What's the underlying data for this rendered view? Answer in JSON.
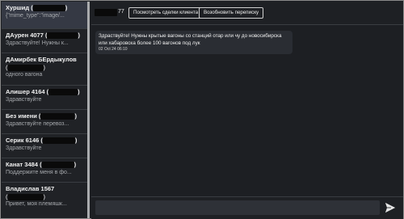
{
  "sidebar": {
    "items": [
      {
        "name": "Хуршид (",
        "name_end": ")",
        "preview": "{\"mime_type\":\"image/...",
        "active": true
      },
      {
        "name": "ДАурен 4077 (",
        "name_end": ")",
        "preview": "Здраствуйте! Нужны к...",
        "active": false
      },
      {
        "name": "ДАмирбек БЕрдыкулов",
        "line2": "(",
        "line2_end": ")",
        "preview": "одного вагона",
        "active": false
      },
      {
        "name": "Алишер 4164 (",
        "name_end": ")",
        "preview": "Здравствуйте",
        "active": false
      },
      {
        "name": "Без имени (",
        "name_end": ")",
        "preview": "Здравствуйте перевоз...",
        "active": false
      },
      {
        "name": "Серик 6146 (",
        "name_end": ")",
        "preview": "Здравствуйте",
        "active": false
      },
      {
        "name": "Канат 3484 (",
        "name_end": ")",
        "preview": "Поддержите меня в фо...",
        "active": false
      },
      {
        "name": "Владислав 1567",
        "line2": "(",
        "line2_end": ")",
        "preview": "Привет, моя племяшк...",
        "active": false
      }
    ]
  },
  "header": {
    "contact_id_suffix": "77",
    "view_deals_label": "Посмотреть сделки клиента",
    "resume_label": "Возобновить переписку"
  },
  "messages": [
    {
      "text": "Здраствуйте! Нужны крытые вагоны со станций отар или чу до новосибирска или хабаровска более 100 вагонов под лук",
      "time": "02 Oct 24 06:10"
    }
  ],
  "composer": {
    "placeholder": "",
    "value": ""
  },
  "icons": {
    "send": "send-icon"
  },
  "colors": {
    "background": "#1d1f23",
    "active_item": "#353944",
    "bubble": "#2a2d33",
    "redaction": "#0a0a0a"
  }
}
